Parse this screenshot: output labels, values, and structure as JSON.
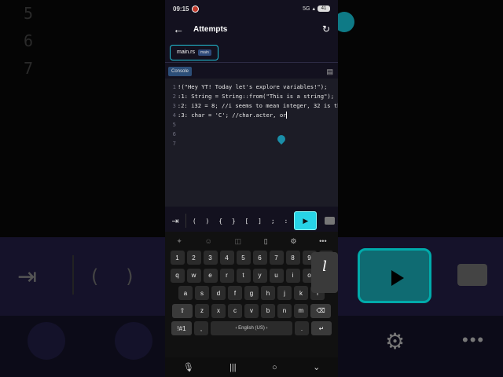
{
  "status": {
    "time": "09:15",
    "network": "5G",
    "battery": "41"
  },
  "app": {
    "title": "Attempts"
  },
  "file_tab": {
    "name": "main.rs",
    "badge": "main"
  },
  "console": {
    "label": "Console"
  },
  "editor": {
    "lines": [
      {
        "n": "1",
        "text": "!(\"Hey YT! Today let's explore variables!\");"
      },
      {
        "n": "2",
        "text": ":1: String = String::from(\"This is a string\");"
      },
      {
        "n": "3",
        "text": ":2: i32 = 8; //i seems to mean integer, 32 is th"
      },
      {
        "n": "4",
        "text": ":3: char = 'C'; //char.acter, or"
      },
      {
        "n": "5",
        "text": ""
      },
      {
        "n": "6",
        "text": ""
      },
      {
        "n": "7",
        "text": ""
      }
    ]
  },
  "symbols": [
    "(",
    ")",
    "{",
    "}",
    "[",
    "]",
    ";",
    ":"
  ],
  "keyboard": {
    "row1": [
      "1",
      "2",
      "3",
      "4",
      "5",
      "6",
      "7",
      "8",
      "9",
      "0"
    ],
    "row2": [
      "q",
      "w",
      "e",
      "r",
      "t",
      "y",
      "u",
      "i",
      "o",
      "p"
    ],
    "row3": [
      "a",
      "s",
      "d",
      "f",
      "g",
      "h",
      "j",
      "k",
      "l"
    ],
    "row4": [
      "z",
      "x",
      "c",
      "v",
      "b",
      "n",
      "m"
    ],
    "symbols_key": "!#1",
    "comma": ",",
    "space_label": "English (US)",
    "period": ".",
    "popup_letter": "l"
  },
  "background": {
    "numbers": [
      "5",
      "6",
      "7"
    ],
    "parens": [
      "(",
      ")"
    ]
  },
  "colors": {
    "accent": "#27d3e6",
    "editor_bg": "#1c1c26",
    "app_bg": "#13111f"
  }
}
